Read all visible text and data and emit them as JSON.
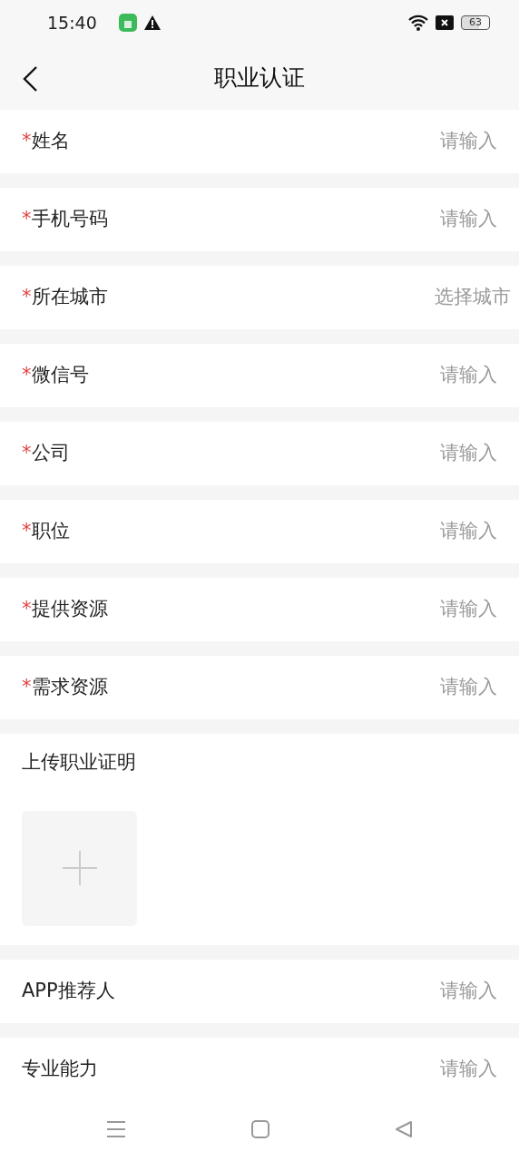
{
  "status_bar": {
    "time": "15:40",
    "battery": "63"
  },
  "header": {
    "title": "职业认证"
  },
  "fields": [
    {
      "kind": "input",
      "mark": "*",
      "label": "姓名",
      "placeholder": "请输入"
    },
    {
      "kind": "input",
      "mark": "*",
      "label": "手机号码",
      "placeholder": "请输入"
    },
    {
      "kind": "select",
      "mark": "*",
      "label": "所在城市",
      "placeholder": "选择城市"
    },
    {
      "kind": "input",
      "mark": "*",
      "label": "微信号",
      "placeholder": "请输入"
    },
    {
      "kind": "input",
      "mark": "*",
      "label": "公司",
      "placeholder": "请输入"
    },
    {
      "kind": "input",
      "mark": "*",
      "label": "职位",
      "placeholder": "请输入"
    },
    {
      "kind": "input",
      "mark": "*",
      "label": "提供资源",
      "placeholder": "请输入"
    },
    {
      "kind": "input",
      "mark": "*",
      "label": "需求资源",
      "placeholder": "请输入"
    },
    {
      "kind": "upload",
      "label": "上传职业证明"
    },
    {
      "kind": "input",
      "label": "APP推荐人",
      "placeholder": "请输入"
    },
    {
      "kind": "input",
      "label": "专业能力",
      "placeholder": "请输入"
    }
  ]
}
